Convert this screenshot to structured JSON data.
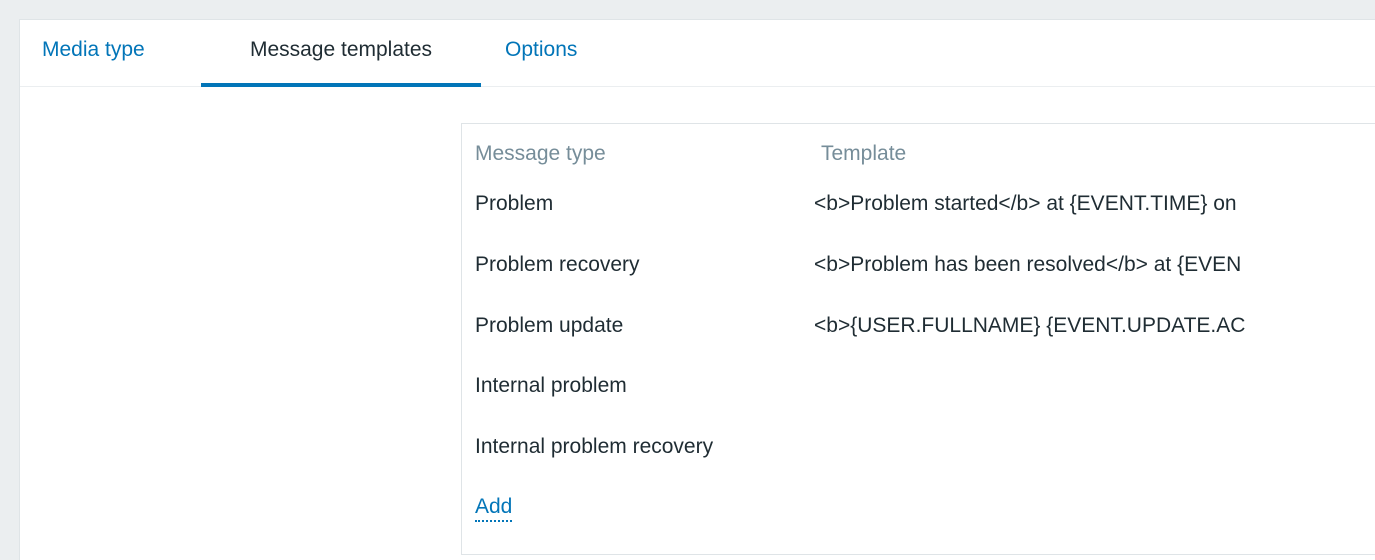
{
  "tabs": [
    {
      "label": "Media type",
      "active": false
    },
    {
      "label": "Message templates",
      "active": true
    },
    {
      "label": "Options",
      "active": false
    }
  ],
  "templates": {
    "headers": {
      "message_type": "Message type",
      "template": "Template"
    },
    "rows": [
      {
        "type": "Problem",
        "template": "<b>Problem started</b> at {EVENT.TIME} on"
      },
      {
        "type": "Problem recovery",
        "template": "<b>Problem has been resolved</b> at {EVEN"
      },
      {
        "type": "Problem update",
        "template": "<b>{USER.FULLNAME} {EVENT.UPDATE.AC"
      },
      {
        "type": "Internal problem",
        "template": ""
      },
      {
        "type": "Internal problem recovery",
        "template": ""
      }
    ],
    "add_label": "Add"
  },
  "colors": {
    "link": "#0275b8",
    "text": "#1f2c33",
    "header_text": "#768d99",
    "page_bg": "#ebeef0"
  }
}
